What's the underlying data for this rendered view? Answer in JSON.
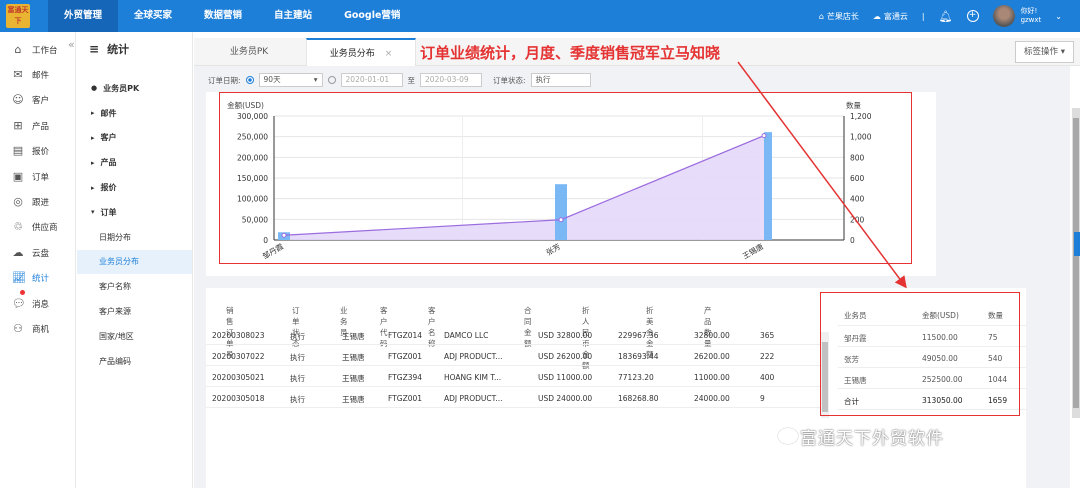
{
  "brand": {
    "logo_text": "富通天下"
  },
  "topnav": [
    "外贸管理",
    "全球买家",
    "数据营销",
    "自主建站",
    "Google营销"
  ],
  "topright": {
    "item1": "芒果店长",
    "item2": "富通云",
    "user_line1": "你好!",
    "user_line2": "gzwxt"
  },
  "sidebar": [
    "工作台",
    "邮件",
    "客户",
    "产品",
    "报价",
    "订单",
    "跟进",
    "供应商",
    "云盘",
    "统计",
    "消息",
    "商机"
  ],
  "subnav": {
    "title": "统计",
    "items": [
      {
        "label": "业务员PK",
        "type": "dot"
      },
      {
        "label": "邮件",
        "type": "arrow"
      },
      {
        "label": "客户",
        "type": "arrow"
      },
      {
        "label": "产品",
        "type": "arrow"
      },
      {
        "label": "报价",
        "type": "arrow"
      },
      {
        "label": "订单",
        "type": "open"
      },
      {
        "label": "日期分布",
        "type": "child"
      },
      {
        "label": "业务员分布",
        "type": "child",
        "active": true
      },
      {
        "label": "客户名称",
        "type": "child"
      },
      {
        "label": "客户来源",
        "type": "child"
      },
      {
        "label": "国家/地区",
        "type": "child"
      },
      {
        "label": "产品编码",
        "type": "child"
      }
    ]
  },
  "tabs": {
    "tab1": "业务员PK",
    "tab2": "业务员分布",
    "close": "×",
    "op": "标签操作 ▾"
  },
  "annotation": "订单业绩统计，月度、季度销售冠军立马知晓",
  "filter": {
    "date_label": "订单日期:",
    "range": "90天",
    "date_from": "2020-01-01",
    "to": "至",
    "date_to": "2020-03-09",
    "status_label": "订单状态:",
    "status": "执行"
  },
  "chart_data": {
    "type": "bar+line",
    "categories": [
      "邹丹霞",
      "张芳",
      "王锡唐"
    ],
    "series": [
      {
        "name": "金额(USD)",
        "type": "line-area",
        "values": [
          11500,
          49050,
          252500
        ]
      },
      {
        "name": "数量",
        "type": "bar",
        "values": [
          75,
          540,
          1044
        ]
      }
    ],
    "ylabel_left": "金额(USD)",
    "ylim_left": [
      0,
      300000
    ],
    "yticks_left": [
      "300,000",
      "250,000",
      "200,000",
      "150,000",
      "100,000",
      "50,000",
      "0"
    ],
    "ylabel_right": "数量",
    "ylim_right": [
      0,
      1200
    ],
    "yticks_right": [
      "1,200",
      "1,000",
      "800",
      "600",
      "400",
      "200",
      "0"
    ],
    "grid": true,
    "colors": {
      "line": "#9c6ce0",
      "area": "#e4d8fa",
      "bar": "#7ab8f5"
    }
  },
  "table": {
    "headers": [
      "销售订单号",
      "订单状态",
      "业务员",
      "客户代码",
      "客户名称",
      "合同金额",
      "折人民币金额",
      "折美金金额",
      "产品数量"
    ],
    "rows": [
      [
        "20200308023",
        "执行",
        "王锡唐",
        "FTGZ014",
        "DAMCO LLC",
        "USD 32800.00",
        "229967.36",
        "32800.00",
        "365"
      ],
      [
        "20200307022",
        "执行",
        "王锡唐",
        "FTGZ001",
        "ADJ PRODUCT...",
        "USD 26200.00",
        "183693.44",
        "26200.00",
        "222"
      ],
      [
        "20200305021",
        "执行",
        "王锡唐",
        "FTGZ394",
        "HOANG KIM T...",
        "USD 11000.00",
        "77123.20",
        "11000.00",
        "400"
      ],
      [
        "20200305018",
        "执行",
        "王锡唐",
        "FTGZ001",
        "ADJ PRODUCT...",
        "USD 24000.00",
        "168268.80",
        "24000.00",
        "9"
      ]
    ]
  },
  "summary": {
    "headers": [
      "业务员",
      "金额(USD)",
      "数量"
    ],
    "rows": [
      [
        "邹丹霞",
        "11500.00",
        "75"
      ],
      [
        "张芳",
        "49050.00",
        "540"
      ],
      [
        "王锡唐",
        "252500.00",
        "1044"
      ],
      [
        "合计",
        "313050.00",
        "1659"
      ]
    ]
  },
  "watermark": "富通天下外贸软件"
}
